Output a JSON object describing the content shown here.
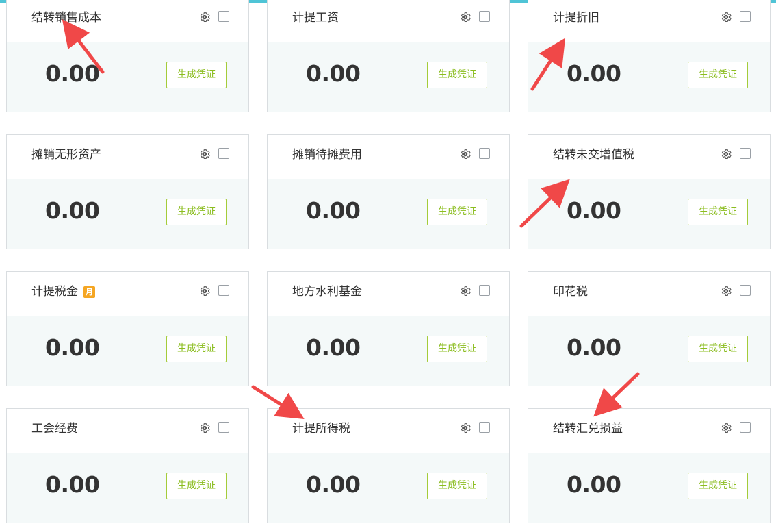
{
  "button_label": "生成凭证",
  "badge": "月",
  "colors": {
    "accent_top": "#4fc4d6",
    "button": "#8bbd1f",
    "badge": "#f5a623",
    "arrow": "#f04848"
  },
  "cards": [
    {
      "title": "结转销售成本",
      "amount": "0.00"
    },
    {
      "title": "计提工资",
      "amount": "0.00"
    },
    {
      "title": "计提折旧",
      "amount": "0.00"
    },
    {
      "title": "摊销无形资产",
      "amount": "0.00"
    },
    {
      "title": "摊销待摊费用",
      "amount": "0.00"
    },
    {
      "title": "结转未交增值税",
      "amount": "0.00"
    },
    {
      "title": "计提税金",
      "amount": "0.00",
      "badge": true
    },
    {
      "title": "地方水利基金",
      "amount": "0.00"
    },
    {
      "title": "印花税",
      "amount": "0.00"
    },
    {
      "title": "工会经费",
      "amount": "0.00"
    },
    {
      "title": "计提所得税",
      "amount": "0.00"
    },
    {
      "title": "结转汇兑损益",
      "amount": "0.00"
    }
  ]
}
